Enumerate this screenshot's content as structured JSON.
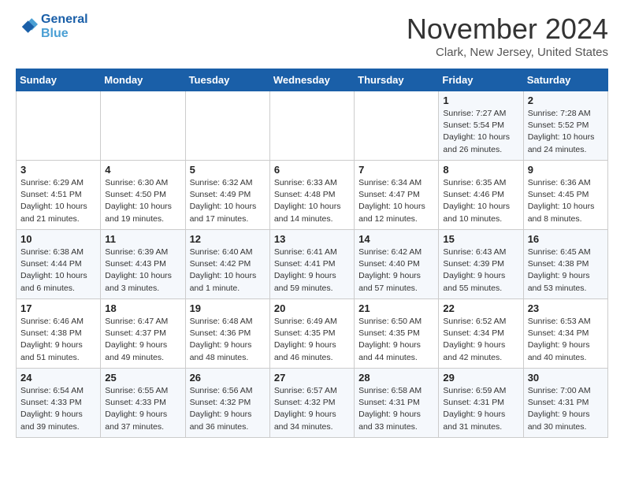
{
  "header": {
    "logo_line1": "General",
    "logo_line2": "Blue",
    "month": "November 2024",
    "location": "Clark, New Jersey, United States"
  },
  "weekdays": [
    "Sunday",
    "Monday",
    "Tuesday",
    "Wednesday",
    "Thursday",
    "Friday",
    "Saturday"
  ],
  "weeks": [
    [
      {
        "day": "",
        "info": ""
      },
      {
        "day": "",
        "info": ""
      },
      {
        "day": "",
        "info": ""
      },
      {
        "day": "",
        "info": ""
      },
      {
        "day": "",
        "info": ""
      },
      {
        "day": "1",
        "info": "Sunrise: 7:27 AM\nSunset: 5:54 PM\nDaylight: 10 hours\nand 26 minutes."
      },
      {
        "day": "2",
        "info": "Sunrise: 7:28 AM\nSunset: 5:52 PM\nDaylight: 10 hours\nand 24 minutes."
      }
    ],
    [
      {
        "day": "3",
        "info": "Sunrise: 6:29 AM\nSunset: 4:51 PM\nDaylight: 10 hours\nand 21 minutes."
      },
      {
        "day": "4",
        "info": "Sunrise: 6:30 AM\nSunset: 4:50 PM\nDaylight: 10 hours\nand 19 minutes."
      },
      {
        "day": "5",
        "info": "Sunrise: 6:32 AM\nSunset: 4:49 PM\nDaylight: 10 hours\nand 17 minutes."
      },
      {
        "day": "6",
        "info": "Sunrise: 6:33 AM\nSunset: 4:48 PM\nDaylight: 10 hours\nand 14 minutes."
      },
      {
        "day": "7",
        "info": "Sunrise: 6:34 AM\nSunset: 4:47 PM\nDaylight: 10 hours\nand 12 minutes."
      },
      {
        "day": "8",
        "info": "Sunrise: 6:35 AM\nSunset: 4:46 PM\nDaylight: 10 hours\nand 10 minutes."
      },
      {
        "day": "9",
        "info": "Sunrise: 6:36 AM\nSunset: 4:45 PM\nDaylight: 10 hours\nand 8 minutes."
      }
    ],
    [
      {
        "day": "10",
        "info": "Sunrise: 6:38 AM\nSunset: 4:44 PM\nDaylight: 10 hours\nand 6 minutes."
      },
      {
        "day": "11",
        "info": "Sunrise: 6:39 AM\nSunset: 4:43 PM\nDaylight: 10 hours\nand 3 minutes."
      },
      {
        "day": "12",
        "info": "Sunrise: 6:40 AM\nSunset: 4:42 PM\nDaylight: 10 hours\nand 1 minute."
      },
      {
        "day": "13",
        "info": "Sunrise: 6:41 AM\nSunset: 4:41 PM\nDaylight: 9 hours\nand 59 minutes."
      },
      {
        "day": "14",
        "info": "Sunrise: 6:42 AM\nSunset: 4:40 PM\nDaylight: 9 hours\nand 57 minutes."
      },
      {
        "day": "15",
        "info": "Sunrise: 6:43 AM\nSunset: 4:39 PM\nDaylight: 9 hours\nand 55 minutes."
      },
      {
        "day": "16",
        "info": "Sunrise: 6:45 AM\nSunset: 4:38 PM\nDaylight: 9 hours\nand 53 minutes."
      }
    ],
    [
      {
        "day": "17",
        "info": "Sunrise: 6:46 AM\nSunset: 4:38 PM\nDaylight: 9 hours\nand 51 minutes."
      },
      {
        "day": "18",
        "info": "Sunrise: 6:47 AM\nSunset: 4:37 PM\nDaylight: 9 hours\nand 49 minutes."
      },
      {
        "day": "19",
        "info": "Sunrise: 6:48 AM\nSunset: 4:36 PM\nDaylight: 9 hours\nand 48 minutes."
      },
      {
        "day": "20",
        "info": "Sunrise: 6:49 AM\nSunset: 4:35 PM\nDaylight: 9 hours\nand 46 minutes."
      },
      {
        "day": "21",
        "info": "Sunrise: 6:50 AM\nSunset: 4:35 PM\nDaylight: 9 hours\nand 44 minutes."
      },
      {
        "day": "22",
        "info": "Sunrise: 6:52 AM\nSunset: 4:34 PM\nDaylight: 9 hours\nand 42 minutes."
      },
      {
        "day": "23",
        "info": "Sunrise: 6:53 AM\nSunset: 4:34 PM\nDaylight: 9 hours\nand 40 minutes."
      }
    ],
    [
      {
        "day": "24",
        "info": "Sunrise: 6:54 AM\nSunset: 4:33 PM\nDaylight: 9 hours\nand 39 minutes."
      },
      {
        "day": "25",
        "info": "Sunrise: 6:55 AM\nSunset: 4:33 PM\nDaylight: 9 hours\nand 37 minutes."
      },
      {
        "day": "26",
        "info": "Sunrise: 6:56 AM\nSunset: 4:32 PM\nDaylight: 9 hours\nand 36 minutes."
      },
      {
        "day": "27",
        "info": "Sunrise: 6:57 AM\nSunset: 4:32 PM\nDaylight: 9 hours\nand 34 minutes."
      },
      {
        "day": "28",
        "info": "Sunrise: 6:58 AM\nSunset: 4:31 PM\nDaylight: 9 hours\nand 33 minutes."
      },
      {
        "day": "29",
        "info": "Sunrise: 6:59 AM\nSunset: 4:31 PM\nDaylight: 9 hours\nand 31 minutes."
      },
      {
        "day": "30",
        "info": "Sunrise: 7:00 AM\nSunset: 4:31 PM\nDaylight: 9 hours\nand 30 minutes."
      }
    ]
  ]
}
